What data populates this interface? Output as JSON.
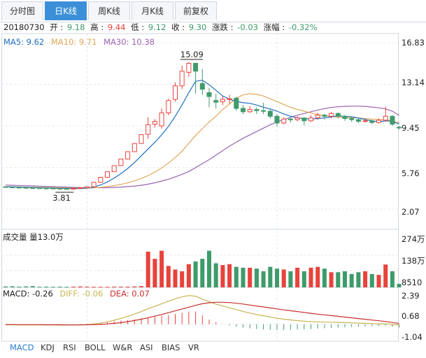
{
  "tabs": [
    {
      "label": "分时图",
      "active": false
    },
    {
      "label": "日K线",
      "active": true
    },
    {
      "label": "周K线",
      "active": false
    },
    {
      "label": "月K线",
      "active": false
    },
    {
      "label": "前复权",
      "active": false
    }
  ],
  "info": {
    "date": "20180730",
    "open_label": "开",
    "open": "9.18",
    "high_label": "高",
    "high": "9.44",
    "low_label": "低",
    "low": "9.12",
    "close_label": "收",
    "close": "9.30",
    "change_label": "涨跌",
    "change": "-0.03",
    "pct_label": "涨幅",
    "pct": "-0.32%"
  },
  "ma_legend": [
    {
      "label": "MA5: 9.62",
      "color": "#1f6fbf"
    },
    {
      "label": "MA10: 9.71",
      "color": "#e0a85a"
    },
    {
      "label": "MA30: 10.38",
      "color": "#9b63b0"
    }
  ],
  "volume_label": "成交量 量13.0万",
  "macd_legend": [
    {
      "label": "MACD: -0.26",
      "color": "#222222"
    },
    {
      "label": "DIFF: -0.06",
      "color": "#c8b450"
    },
    {
      "label": "DEA: 0.07",
      "color": "#c9302c"
    }
  ],
  "indicator_tabs": [
    {
      "label": "MACD",
      "active": true
    },
    {
      "label": "KDJ",
      "active": false
    },
    {
      "label": "RSI",
      "active": false
    },
    {
      "label": "BOLL",
      "active": false
    },
    {
      "label": "W&R",
      "active": false
    },
    {
      "label": "ASI",
      "active": false
    },
    {
      "label": "BIAS",
      "active": false
    },
    {
      "label": "VR",
      "active": false
    }
  ],
  "colors": {
    "up": "#e8433c",
    "down": "#3e9b6a",
    "ma5": "#1f6fbf",
    "ma10": "#e0a85a",
    "ma30": "#9b63b0",
    "diff": "#c8b450",
    "dea": "#c9302c"
  },
  "chart_data": {
    "type": "candlestick",
    "price_axis": {
      "ticks": [
        "16.83",
        "13.14",
        "9.45",
        "5.76",
        "2.07"
      ],
      "min": 2.07,
      "max": 16.83
    },
    "volume_axis": {
      "ticks": [
        "274万",
        "138万",
        "8510"
      ],
      "max": 274
    },
    "macd_axis": {
      "ticks": [
        "2.39",
        "0.68",
        "-1.04"
      ],
      "min": -1.04,
      "max": 2.39
    },
    "annotations": [
      {
        "label": "15.09",
        "value": 15.09
      },
      {
        "label": "3.81",
        "value": 3.81
      }
    ],
    "candles": [
      [
        4.05,
        4.02,
        4.08,
        3.99
      ],
      [
        4.02,
        4.0,
        4.05,
        3.97
      ],
      [
        4.0,
        3.98,
        4.03,
        3.95
      ],
      [
        3.98,
        3.96,
        4.01,
        3.93
      ],
      [
        3.96,
        3.95,
        3.99,
        3.92
      ],
      [
        3.95,
        3.93,
        3.98,
        3.9
      ],
      [
        3.93,
        3.92,
        3.96,
        3.89
      ],
      [
        3.92,
        3.9,
        3.95,
        3.86
      ],
      [
        3.9,
        3.88,
        3.93,
        3.83
      ],
      [
        3.88,
        3.86,
        3.91,
        3.81
      ],
      [
        3.86,
        3.9,
        3.92,
        3.84
      ],
      [
        3.9,
        3.95,
        3.97,
        3.88
      ],
      [
        3.95,
        4.05,
        4.08,
        3.93
      ],
      [
        4.05,
        4.45,
        4.45,
        4.03
      ],
      [
        4.45,
        4.89,
        4.89,
        4.45
      ],
      [
        4.89,
        5.38,
        5.38,
        4.89
      ],
      [
        5.38,
        5.92,
        5.92,
        5.38
      ],
      [
        5.92,
        6.51,
        6.51,
        5.92
      ],
      [
        6.51,
        7.16,
        7.16,
        6.51
      ],
      [
        7.16,
        7.88,
        7.88,
        7.16
      ],
      [
        7.88,
        8.67,
        8.67,
        7.88
      ],
      [
        8.7,
        9.55,
        10.2,
        8.3
      ],
      [
        9.6,
        9.85,
        10.05,
        9.3
      ],
      [
        9.45,
        10.6,
        11.0,
        9.2
      ],
      [
        10.6,
        11.7,
        11.85,
        10.4
      ],
      [
        11.8,
        13.0,
        13.3,
        11.6
      ],
      [
        13.0,
        14.3,
        14.8,
        12.7
      ],
      [
        14.2,
        15.0,
        15.09,
        13.8
      ],
      [
        15.0,
        14.3,
        14.9,
        12.3
      ],
      [
        13.2,
        12.7,
        14.5,
        12.2
      ],
      [
        12.4,
        12.05,
        12.8,
        11.1
      ],
      [
        11.7,
        11.55,
        12.3,
        11.0
      ],
      [
        11.6,
        11.8,
        12.1,
        11.3
      ],
      [
        11.8,
        11.85,
        12.2,
        11.4
      ],
      [
        11.9,
        11.0,
        12.05,
        10.8
      ],
      [
        11.0,
        10.7,
        11.3,
        10.5
      ],
      [
        10.7,
        10.9,
        11.2,
        10.6
      ],
      [
        10.9,
        10.8,
        11.1,
        10.5
      ],
      [
        10.8,
        10.75,
        11.5,
        10.5
      ],
      [
        10.75,
        10.3,
        10.9,
        10.1
      ],
      [
        10.3,
        9.7,
        10.5,
        9.4
      ],
      [
        9.7,
        10.05,
        10.2,
        9.6
      ],
      [
        10.05,
        10.0,
        10.2,
        9.75
      ],
      [
        10.0,
        10.15,
        10.3,
        9.85
      ],
      [
        10.15,
        9.9,
        10.2,
        9.5
      ],
      [
        9.9,
        10.15,
        10.4,
        9.8
      ],
      [
        10.15,
        10.4,
        10.6,
        10.0
      ],
      [
        10.4,
        10.3,
        10.5,
        10.0
      ],
      [
        10.3,
        10.55,
        10.7,
        10.1
      ],
      [
        10.55,
        10.3,
        10.65,
        10.1
      ],
      [
        10.3,
        10.1,
        10.4,
        9.9
      ],
      [
        10.1,
        10.0,
        10.2,
        9.8
      ],
      [
        10.0,
        9.85,
        10.1,
        9.7
      ],
      [
        9.85,
        9.9,
        10.1,
        9.75
      ],
      [
        9.9,
        9.75,
        10.0,
        9.6
      ],
      [
        9.75,
        9.95,
        10.1,
        9.65
      ],
      [
        9.95,
        10.3,
        11.15,
        9.8
      ],
      [
        10.3,
        9.6,
        10.4,
        9.45
      ],
      [
        9.33,
        9.3,
        9.44,
        9.12
      ]
    ],
    "volumes": [
      5,
      6,
      4,
      5,
      7,
      3,
      4,
      3,
      4,
      3,
      4,
      5,
      4,
      3,
      3,
      3,
      4,
      4,
      4,
      5,
      7,
      200,
      160,
      205,
      120,
      100,
      90,
      130,
      145,
      160,
      205,
      135,
      125,
      130,
      115,
      110,
      110,
      105,
      90,
      115,
      105,
      100,
      90,
      110,
      90,
      110,
      115,
      105,
      85,
      85,
      90,
      75,
      85,
      90,
      75,
      70,
      128,
      90,
      20
    ],
    "macd_hist": [
      -0.05,
      -0.05,
      -0.05,
      -0.04,
      -0.04,
      -0.04,
      -0.03,
      -0.03,
      -0.03,
      -0.02,
      0.02,
      0.03,
      0.05,
      0.08,
      0.12,
      0.18,
      0.25,
      0.3,
      0.36,
      0.42,
      0.5,
      0.58,
      0.64,
      0.7,
      0.76,
      0.85,
      0.95,
      1.05,
      1.05,
      0.72,
      0.38,
      0.18,
      0.02,
      -0.1,
      -0.2,
      -0.27,
      -0.33,
      -0.38,
      -0.42,
      -0.45,
      -0.46,
      -0.45,
      -0.44,
      -0.42,
      -0.4,
      -0.38,
      -0.35,
      -0.32,
      -0.3,
      -0.27,
      -0.25,
      -0.22,
      -0.2,
      -0.18,
      -0.16,
      -0.14,
      -0.12,
      -0.2,
      -0.26
    ],
    "ma5": [
      4.05,
      4.04,
      4.02,
      4.0,
      3.98,
      3.96,
      3.94,
      3.93,
      3.91,
      3.9,
      3.9,
      3.9,
      3.92,
      4.01,
      4.21,
      4.47,
      4.81,
      5.22,
      5.67,
      6.2,
      6.8,
      7.4,
      8.0,
      8.65,
      9.4,
      10.3,
      11.3,
      12.4,
      13.4,
      13.5,
      13.1,
      12.6,
      12.1,
      11.8,
      11.62,
      11.5,
      11.45,
      11.3,
      11.1,
      10.95,
      10.75,
      10.5,
      10.3,
      10.15,
      10.1,
      10.05,
      10.1,
      10.15,
      10.25,
      10.33,
      10.3,
      10.25,
      10.15,
      10.0,
      9.9,
      9.8,
      9.9,
      9.85,
      9.62
    ],
    "ma10": [
      4.06,
      4.05,
      4.04,
      4.02,
      4.01,
      4.0,
      3.98,
      3.97,
      3.96,
      3.95,
      3.94,
      3.93,
      3.93,
      3.95,
      3.99,
      4.07,
      4.15,
      4.26,
      4.4,
      4.57,
      4.78,
      5.04,
      5.35,
      5.72,
      6.15,
      6.64,
      7.2,
      7.9,
      8.6,
      9.2,
      9.8,
      10.3,
      10.9,
      11.4,
      11.9,
      12.2,
      12.3,
      12.25,
      12.1,
      11.85,
      11.6,
      11.35,
      11.1,
      10.9,
      10.75,
      10.6,
      10.45,
      10.35,
      10.28,
      10.23,
      10.2,
      10.18,
      10.15,
      10.1,
      10.05,
      10.0,
      9.98,
      9.88,
      9.71
    ],
    "ma30": [
      4.2,
      4.18,
      4.16,
      4.14,
      4.12,
      4.1,
      4.08,
      4.06,
      4.04,
      4.02,
      4.0,
      3.98,
      3.97,
      3.96,
      3.96,
      3.97,
      3.99,
      4.02,
      4.06,
      4.11,
      4.18,
      4.28,
      4.4,
      4.55,
      4.72,
      4.92,
      5.15,
      5.4,
      5.75,
      6.1,
      6.45,
      6.85,
      7.25,
      7.65,
      8.0,
      8.35,
      8.65,
      8.95,
      9.25,
      9.55,
      9.8,
      10.0,
      10.2,
      10.4,
      10.55,
      10.7,
      10.85,
      10.98,
      11.08,
      11.14,
      11.18,
      11.2,
      11.2,
      11.18,
      11.12,
      11.05,
      10.95,
      10.75,
      10.38
    ],
    "diff": [
      -0.04,
      -0.04,
      -0.05,
      -0.05,
      -0.05,
      -0.05,
      -0.05,
      -0.05,
      -0.06,
      -0.06,
      -0.05,
      -0.04,
      -0.02,
      0.03,
      0.1,
      0.2,
      0.33,
      0.48,
      0.65,
      0.84,
      1.04,
      1.28,
      1.48,
      1.68,
      1.88,
      2.08,
      2.25,
      2.35,
      2.3,
      2.05,
      1.85,
      1.65,
      1.5,
      1.35,
      1.2,
      1.05,
      0.92,
      0.8,
      0.7,
      0.6,
      0.5,
      0.42,
      0.36,
      0.3,
      0.26,
      0.22,
      0.2,
      0.18,
      0.17,
      0.16,
      0.14,
      0.12,
      0.1,
      0.08,
      0.06,
      0.04,
      0.04,
      -0.01,
      -0.06
    ],
    "dea": [
      -0.02,
      -0.02,
      -0.03,
      -0.03,
      -0.03,
      -0.03,
      -0.04,
      -0.04,
      -0.04,
      -0.05,
      -0.05,
      -0.05,
      -0.04,
      -0.03,
      -0.01,
      0.03,
      0.08,
      0.14,
      0.22,
      0.31,
      0.42,
      0.54,
      0.67,
      0.8,
      0.95,
      1.1,
      1.25,
      1.4,
      1.55,
      1.68,
      1.76,
      1.8,
      1.8,
      1.78,
      1.72,
      1.66,
      1.58,
      1.5,
      1.42,
      1.34,
      1.26,
      1.18,
      1.11,
      1.04,
      0.97,
      0.9,
      0.83,
      0.77,
      0.71,
      0.65,
      0.59,
      0.53,
      0.47,
      0.41,
      0.35,
      0.29,
      0.23,
      0.15,
      0.07
    ]
  }
}
